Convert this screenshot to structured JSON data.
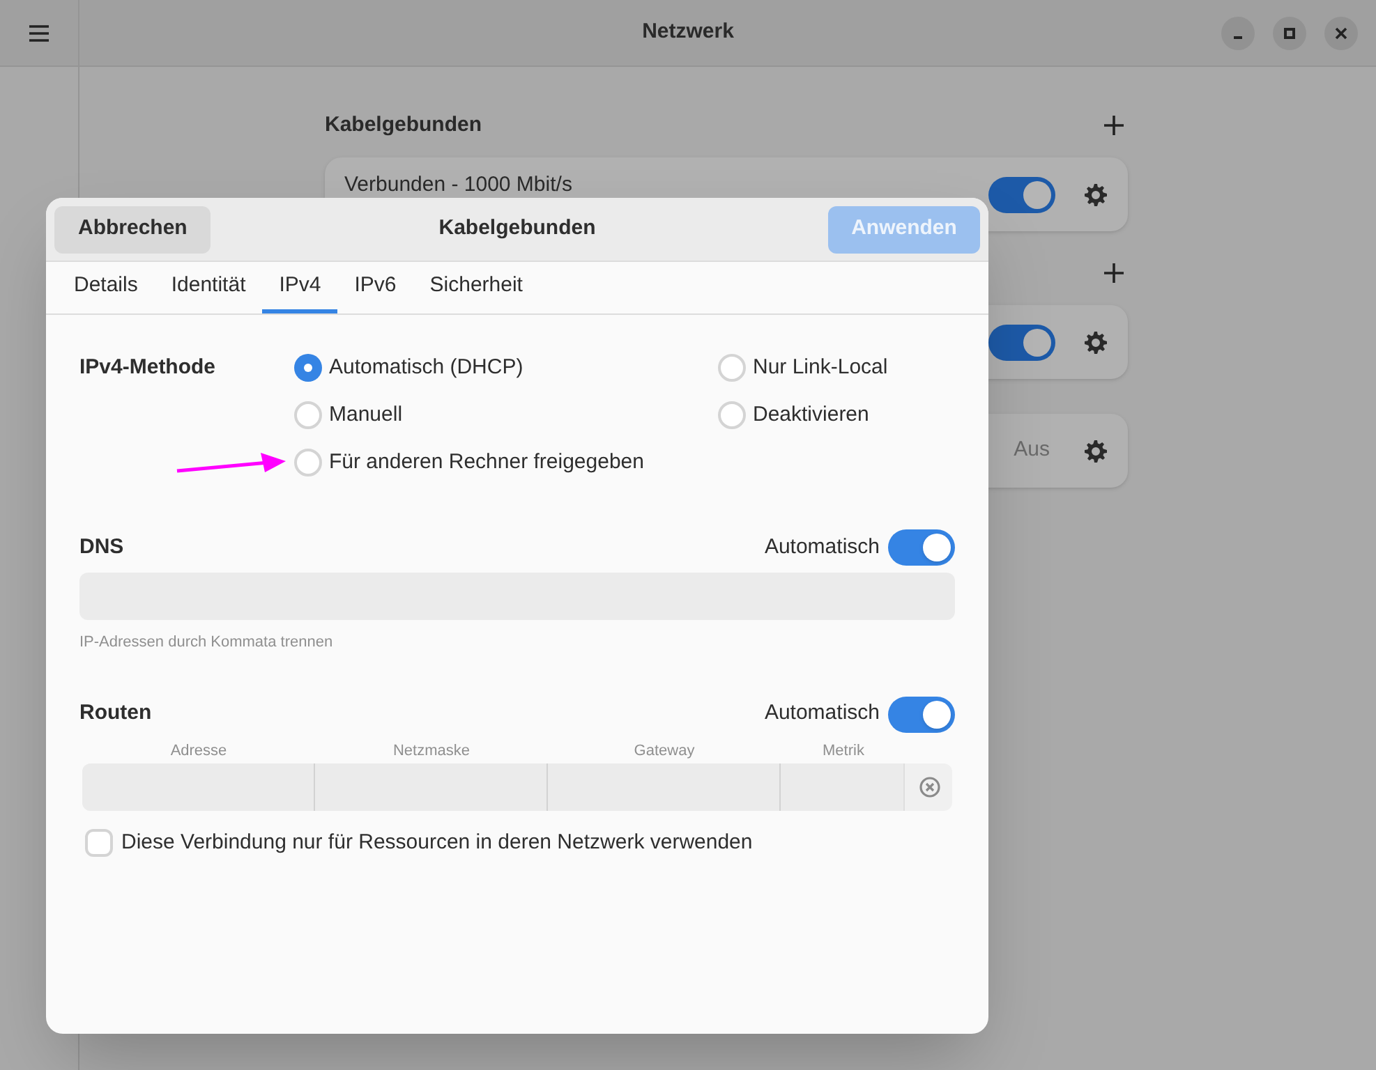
{
  "window": {
    "title": "Netzwerk"
  },
  "sections": [
    {
      "title": "Kabelgebunden",
      "cards": [
        {
          "kind": "toggle",
          "status": "Verbunden - 1000 Mbit/s",
          "on": true
        }
      ]
    },
    {
      "cards": [
        {
          "kind": "toggle",
          "on": true
        },
        {
          "kind": "status",
          "status": "Aus"
        }
      ]
    }
  ],
  "dialog": {
    "title": "Kabelgebunden",
    "cancel": "Abbrechen",
    "apply": {
      "label": "Anwenden",
      "disabled": true
    },
    "tabs": [
      {
        "label": "Details",
        "selected": false
      },
      {
        "label": "Identität",
        "selected": false
      },
      {
        "label": "IPv4",
        "selected": true
      },
      {
        "label": "IPv6",
        "selected": false
      },
      {
        "label": "Sicherheit",
        "selected": false
      }
    ],
    "method": {
      "label": "IPv4-Methode",
      "options": [
        {
          "label": "Automatisch (DHCP)",
          "selected": true
        },
        {
          "label": "Nur Link-Local",
          "selected": false
        },
        {
          "label": "Manuell",
          "selected": false
        },
        {
          "label": "Deaktivieren",
          "selected": false
        },
        {
          "label": "Für anderen Rechner freigegeben",
          "selected": false
        }
      ]
    },
    "dns": {
      "label": "DNS",
      "auto_label": "Automatisch",
      "auto": true,
      "hint": "IP-Adressen durch Kommata trennen"
    },
    "routes": {
      "label": "Routen",
      "auto_label": "Automatisch",
      "auto": true,
      "columns": [
        "Adresse",
        "Netzmaske",
        "Gateway",
        "Metrik"
      ]
    },
    "local_only": {
      "label": "Diese Verbindung nur für Ressourcen in deren Netzwerk verwenden",
      "checked": false
    }
  }
}
